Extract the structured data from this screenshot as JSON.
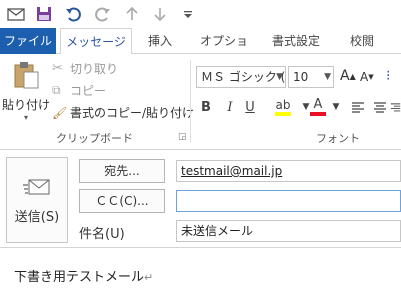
{
  "quick_access": {
    "icons": [
      "outlook-icon",
      "save-icon",
      "undo-icon",
      "redo-icon",
      "up-arrow-icon",
      "down-arrow-icon",
      "customize-icon"
    ]
  },
  "tabs": {
    "file": "ファイル",
    "message": "メッセージ",
    "insert": "挿入",
    "options": "オプション",
    "format": "書式設定",
    "review": "校閲"
  },
  "clipboard": {
    "paste": "貼り付け",
    "cut": "切り取り",
    "copy": "コピー",
    "format_painter": "書式のコピー/貼り付け",
    "group_label": "クリップボード"
  },
  "font": {
    "font_name": "ＭＳ ゴシック (本",
    "font_size": "10",
    "group_label": "フォント",
    "bold": "B",
    "italic": "I",
    "underline": "U",
    "grow": "A",
    "shrink": "A",
    "highlight_color": "#ffff00",
    "font_color": "#e81123"
  },
  "header": {
    "send_label": "送信(S)",
    "to_button": "宛先...",
    "cc_button": "ＣＣ(C)...",
    "subject_label": "件名(U)",
    "to_value": "testmail@mail.jp",
    "cc_value": "",
    "subject_value": "未送信メール"
  },
  "body": {
    "text": "下書き用テストメール",
    "mark": "↵"
  },
  "colors": {
    "file_tab": "#1c5fae",
    "accent": "#2b579a"
  }
}
